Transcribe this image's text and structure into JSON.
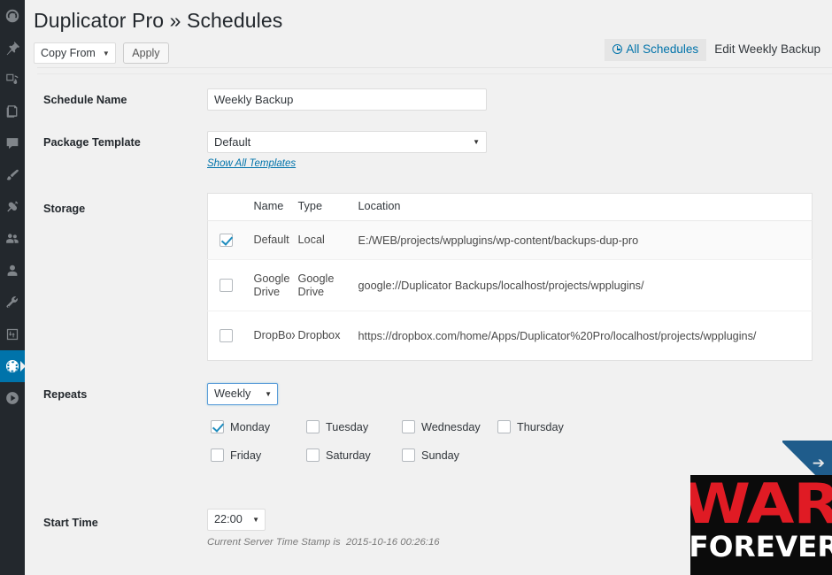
{
  "sidebar": {
    "items": [
      {
        "name": "dashboard",
        "icon": "dashboard-icon",
        "active": false
      },
      {
        "name": "posts",
        "icon": "pin-icon",
        "active": false
      },
      {
        "name": "media",
        "icon": "media-icon",
        "active": false
      },
      {
        "name": "pages",
        "icon": "pages-icon",
        "active": false
      },
      {
        "name": "comments",
        "icon": "comment-icon",
        "active": false
      },
      {
        "name": "appearance",
        "icon": "brush-icon",
        "active": false
      },
      {
        "name": "plugins",
        "icon": "plug-icon",
        "active": false
      },
      {
        "name": "users",
        "icon": "users-icon",
        "active": false
      },
      {
        "name": "profile",
        "icon": "user-icon",
        "active": false
      },
      {
        "name": "tools",
        "icon": "wrench-icon",
        "active": false
      },
      {
        "name": "settings",
        "icon": "sliders-icon",
        "active": false
      },
      {
        "name": "duplicator-pro",
        "icon": "globe-icon",
        "active": true
      },
      {
        "name": "media-play",
        "icon": "play-circle-icon",
        "active": false
      }
    ]
  },
  "header": {
    "title": "Duplicator Pro » Schedules"
  },
  "toolbar": {
    "copy_from_label": "Copy From",
    "apply_label": "Apply"
  },
  "tabs": [
    {
      "label": "All Schedules",
      "icon": "clock-icon",
      "active": true
    },
    {
      "label": "Edit Weekly Backup",
      "icon": "",
      "active": false
    }
  ],
  "form": {
    "schedule_name": {
      "label": "Schedule Name",
      "value": "Weekly Backup",
      "placeholder": ""
    },
    "package_template": {
      "label": "Package Template",
      "value": "Default",
      "link_label": "Show All Templates"
    },
    "storage": {
      "label": "Storage",
      "columns": [
        "Name",
        "Type",
        "Location"
      ],
      "rows": [
        {
          "checked": true,
          "name": "Default",
          "type": "Local",
          "location": "E:/WEB/projects/wpplugins/wp-content/backups-dup-pro"
        },
        {
          "checked": false,
          "name": "Google Drive",
          "type": "Google Drive",
          "location": "google://Duplicator Backups/localhost/projects/wpplugins/"
        },
        {
          "checked": false,
          "name": "DropBox",
          "type": "Dropbox",
          "location": "https://dropbox.com/home/Apps/Duplicator%20Pro/localhost/projects/wpplugins/"
        }
      ]
    },
    "repeats": {
      "label": "Repeats",
      "value": "Weekly",
      "days": [
        {
          "label": "Monday",
          "checked": true
        },
        {
          "label": "Tuesday",
          "checked": false
        },
        {
          "label": "Wednesday",
          "checked": false
        },
        {
          "label": "Thursday",
          "checked": false
        },
        {
          "label": "Friday",
          "checked": false
        },
        {
          "label": "Saturday",
          "checked": false
        },
        {
          "label": "Sunday",
          "checked": false
        }
      ]
    },
    "start_time": {
      "label": "Start Time",
      "value": "22:00",
      "server_time_note": "Current Server Time Stamp is  2015-10-16 00:26:16"
    }
  },
  "watermark": {
    "line1": "WAR",
    "line2": "FOREVER"
  },
  "colors": {
    "sidebar_bg": "#23282d",
    "accent": "#0073aa",
    "page_bg": "#f1f1f1",
    "checkbox_check": "#1e8cbe",
    "watermark_red": "#e01b24",
    "ribbon_blue": "#1f5c8b"
  }
}
